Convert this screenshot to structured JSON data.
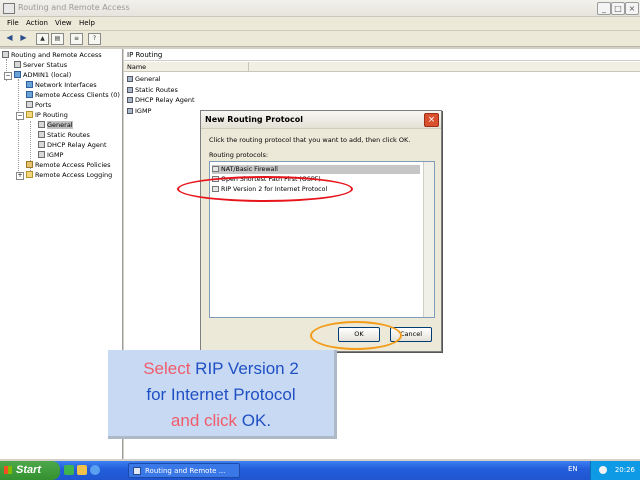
{
  "window": {
    "title": "Routing and Remote Access",
    "menu": [
      "File",
      "Action",
      "View",
      "Help"
    ],
    "controls": [
      "minimize",
      "maximize",
      "close"
    ]
  },
  "toolbar": {
    "icons": [
      "back-arrow-icon",
      "forward-arrow-icon",
      "up-folder-icon",
      "show-hide-tree-icon",
      "export-list-icon",
      "help-icon"
    ]
  },
  "tree": {
    "root": "Routing and Remote Access",
    "server_status": "Server Status",
    "server": "ADMIN1 (local)",
    "network_interfaces": "Network Interfaces",
    "remote_access_clients": "Remote Access Clients (0)",
    "ports": "Ports",
    "ip_routing": "IP Routing",
    "general": "General",
    "static_routes": "Static Routes",
    "dhcp_relay_agent": "DHCP Relay Agent",
    "igmp": "IGMP",
    "remote_access_policies": "Remote Access Policies",
    "remote_access_logging": "Remote Access Logging"
  },
  "right_pane": {
    "header": "IP Routing",
    "column": "Name",
    "rows": [
      "General",
      "Static Routes",
      "DHCP Relay Agent",
      "IGMP"
    ]
  },
  "dialog": {
    "title": "New Routing Protocol",
    "instruction": "Click the routing protocol that you want to add, then click OK.",
    "list_label": "Routing protocols:",
    "items": [
      "NAT/Basic Firewall",
      "Open Shortest Path First (OSPF)",
      "RIP Version 2 for Internet Protocol"
    ],
    "ok": "OK",
    "cancel": "Cancel",
    "highlight_color": "#e8141c",
    "ok_highlight_color": "#f39c1a"
  },
  "instruction_box": {
    "w1": "Select",
    "w2": "RIP Version 2",
    "w3": "for Internet Protocol",
    "w4": "and click",
    "w5": "OK."
  },
  "taskbar": {
    "start": "Start",
    "task": "Routing and Remote ...",
    "lang": "EN",
    "clock": "20:26"
  }
}
